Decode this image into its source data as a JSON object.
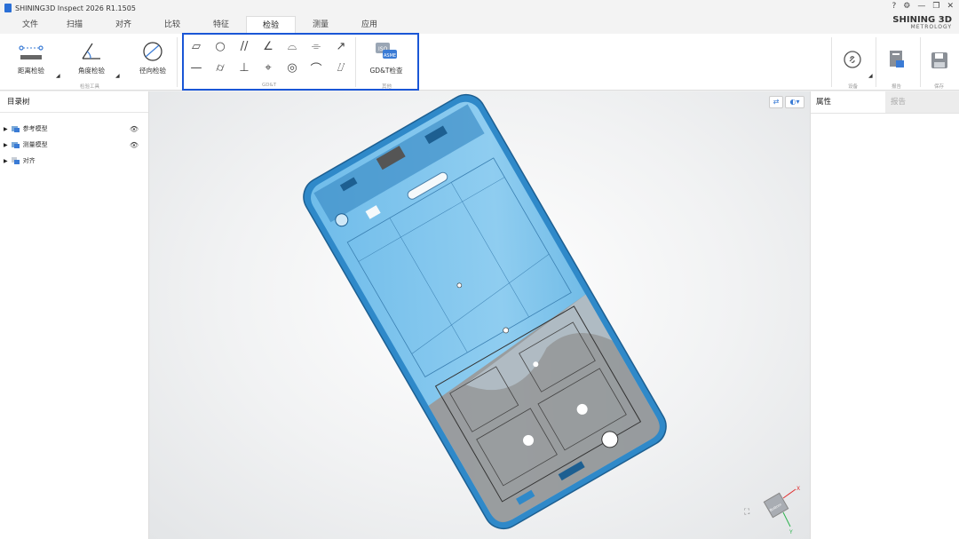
{
  "window": {
    "title": "SHINING3D Inspect 2026 R1.1505",
    "controls": [
      "?",
      "⚙",
      "—",
      "❐",
      "✕"
    ]
  },
  "brand": {
    "line1": "SHINING 3D",
    "line2": "METROLOGY"
  },
  "menu": {
    "items": [
      "文件",
      "扫描",
      "对齐",
      "比较",
      "特征",
      "检验",
      "测量",
      "应用"
    ],
    "active": "检验"
  },
  "ribbon": {
    "distance": "距离检验",
    "angle": "角度检验",
    "radial": "径向检验",
    "group_tools": "检验工具",
    "group_gdt": "GD&T",
    "gdt_check": "GD&T检查",
    "group_other": "其他",
    "iso_badge_top": "ISO",
    "iso_badge_bottom": "ASME",
    "device_label": "设备",
    "report_label": "报告",
    "save_label": "保存",
    "gdt_symbols_row1": [
      "▱",
      "○",
      "//",
      "∠",
      "⌓",
      "⌯",
      "↗"
    ],
    "gdt_symbols_row2": [
      "—",
      "⌭",
      "⊥",
      "⌖",
      "◎",
      "⌒",
      "⌰"
    ]
  },
  "sidebar": {
    "title": "目录树",
    "items": [
      {
        "label": "参考模型",
        "visible_icon": "👁"
      },
      {
        "label": "测量模型",
        "visible_icon": "👁"
      },
      {
        "label": "对齐",
        "visible_icon": ""
      }
    ]
  },
  "properties": {
    "tabs": [
      "属性",
      "报告"
    ],
    "active": "属性"
  },
  "axes": {
    "x": "X",
    "y": "Y",
    "cube_label": "Bottom"
  },
  "colors": {
    "accent": "#1a56d6",
    "model_blue": "#5aaee0",
    "model_gray": "#9a9a9a"
  }
}
